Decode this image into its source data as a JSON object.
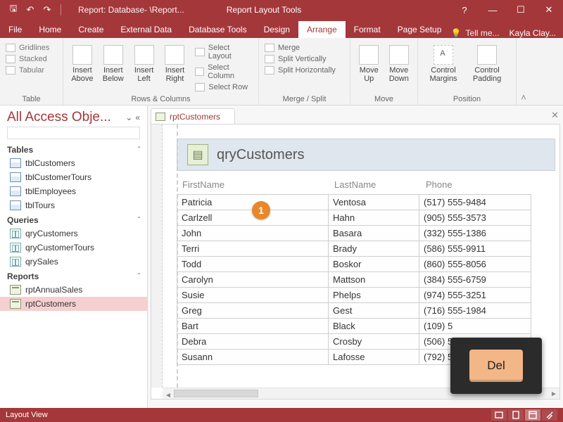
{
  "titlebar": {
    "document": "Report: Database- \\Report...",
    "context": "Report Layout Tools"
  },
  "tabs": {
    "file": "File",
    "home": "Home",
    "create": "Create",
    "external": "External Data",
    "dbtools": "Database Tools",
    "design": "Design",
    "arrange": "Arrange",
    "format": "Format",
    "pagesetup": "Page Setup",
    "tellme": "Tell me...",
    "user": "Kayla Clay..."
  },
  "ribbon": {
    "table": {
      "gridlines": "Gridlines",
      "stacked": "Stacked",
      "tabular": "Tabular",
      "label": "Table"
    },
    "rowscols": {
      "ia": "Insert Above",
      "ib": "Insert Below",
      "il": "Insert Left",
      "ir": "Insert Right",
      "sl": "Select Layout",
      "sc": "Select Column",
      "sr": "Select Row",
      "label": "Rows & Columns"
    },
    "merge": {
      "m": "Merge",
      "sv": "Split Vertically",
      "sh": "Split Horizontally",
      "label": "Merge / Split"
    },
    "move": {
      "up": "Move Up",
      "down": "Move Down",
      "label": "Move"
    },
    "position": {
      "cm": "Control Margins",
      "cp": "Control Padding",
      "label": "Position"
    }
  },
  "nav": {
    "title": "All Access Obje...",
    "tables": {
      "label": "Tables",
      "items": [
        "tblCustomers",
        "tblCustomerTours",
        "tblEmployees",
        "tblTours"
      ]
    },
    "queries": {
      "label": "Queries",
      "items": [
        "qryCustomers",
        "qryCustomerTours",
        "qrySales"
      ]
    },
    "reports": {
      "label": "Reports",
      "items": [
        "rptAnnualSales",
        "rptCustomers"
      ],
      "selected": 1
    }
  },
  "doc": {
    "tab": "rptCustomers",
    "title": "qryCustomers",
    "headers": {
      "first": "FirstName",
      "last": "LastName",
      "phone": "Phone"
    },
    "rows": [
      {
        "f": "Patricia",
        "l": "Ventosa",
        "p": "(517) 555-9484"
      },
      {
        "f": "Carlzell",
        "l": "Hahn",
        "p": "(905) 555-3573"
      },
      {
        "f": "John",
        "l": "Basara",
        "p": "(332) 555-1386"
      },
      {
        "f": "Terri",
        "l": "Brady",
        "p": "(586) 555-9911"
      },
      {
        "f": "Todd",
        "l": "Boskor",
        "p": "(860) 555-8056"
      },
      {
        "f": "Carolyn",
        "l": "Mattson",
        "p": "(384) 555-6759"
      },
      {
        "f": "Susie",
        "l": "Phelps",
        "p": "(974) 555-3251"
      },
      {
        "f": "Greg",
        "l": "Gest",
        "p": "(716) 555-1984"
      },
      {
        "f": "Bart",
        "l": "Black",
        "p": "(109) 5"
      },
      {
        "f": "Debra",
        "l": "Crosby",
        "p": "(506) 5"
      },
      {
        "f": "Susann",
        "l": "Lafosse",
        "p": "(792) 5"
      }
    ]
  },
  "annotations": {
    "marker1": "1",
    "keycap": "Del"
  },
  "status": {
    "view": "Layout View"
  }
}
